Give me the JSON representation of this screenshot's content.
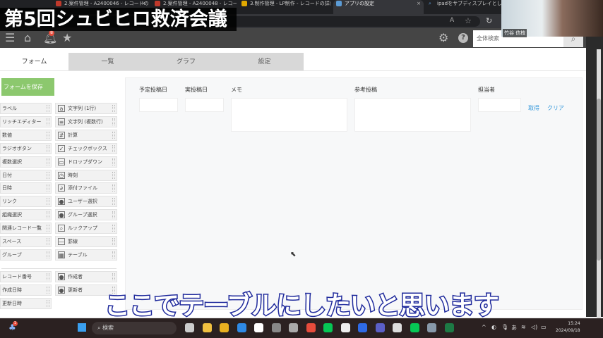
{
  "overlay_title": "第5回シュビヒロ救済会議",
  "subtitle": "ここでテーブルにしたいと思います",
  "browser": {
    "tabs": [
      {
        "label": "2.案件管理 - A2400046 - レコードの",
        "color": "#c0392b"
      },
      {
        "label": "2.案件管理 - A2400048 - レコードの",
        "color": "#c0392b"
      },
      {
        "label": "3.制作管理 - LP制作 - レコードの詳細",
        "color": "#e0a800"
      },
      {
        "label": "アプリの設定",
        "color": "#5b9bd5"
      },
      {
        "label": "ipadをサブディスプレイとして使う win",
        "color": "#202124"
      }
    ]
  },
  "header": {
    "notification_count": "8",
    "search_placeholder": "全体検索"
  },
  "webcam": {
    "name": "竹谷 信枝"
  },
  "tabs": [
    {
      "label": "フォーム"
    },
    {
      "label": "一覧"
    },
    {
      "label": "グラフ"
    },
    {
      "label": "設定"
    }
  ],
  "save_button": "フォームを保存",
  "palette": {
    "left": [
      "ラベル",
      "リッチエディター",
      "数値",
      "ラジオボタン",
      "複数選択",
      "日付",
      "日時",
      "リンク",
      "組織選択",
      "関連レコード一覧",
      "スペース",
      "グループ"
    ],
    "right": [
      {
        "label": "文字列 (1行)",
        "icon": "text-single-icon"
      },
      {
        "label": "文字列 (複数行)",
        "icon": "text-multi-icon"
      },
      {
        "label": "計算",
        "icon": "calculator-icon"
      },
      {
        "label": "チェックボックス",
        "icon": "checkbox-icon"
      },
      {
        "label": "ドロップダウン",
        "icon": "dropdown-icon"
      },
      {
        "label": "時刻",
        "icon": "clock-icon"
      },
      {
        "label": "添付ファイル",
        "icon": "paperclip-icon"
      },
      {
        "label": "ユーザー選択",
        "icon": "user-icon"
      },
      {
        "label": "グループ選択",
        "icon": "group-icon"
      },
      {
        "label": "ルックアップ",
        "icon": "lookup-icon"
      },
      {
        "label": "罫線",
        "icon": "line-icon"
      },
      {
        "label": "テーブル",
        "icon": "table-icon"
      }
    ],
    "system_left": [
      "レコード番号",
      "作成日時",
      "更新日時"
    ],
    "system_right": [
      "作成者",
      "更新者"
    ]
  },
  "form": {
    "fields": [
      {
        "label": "予定投稿日"
      },
      {
        "label": "実投稿日"
      },
      {
        "label": "メモ"
      },
      {
        "label": "参考投稿"
      },
      {
        "label": "担当者"
      }
    ],
    "get_link": "取得",
    "clear_link": "クリア"
  },
  "taskbar": {
    "search": "検索",
    "time": "15:24",
    "date": "2024/09/18",
    "notification_count": "1"
  }
}
